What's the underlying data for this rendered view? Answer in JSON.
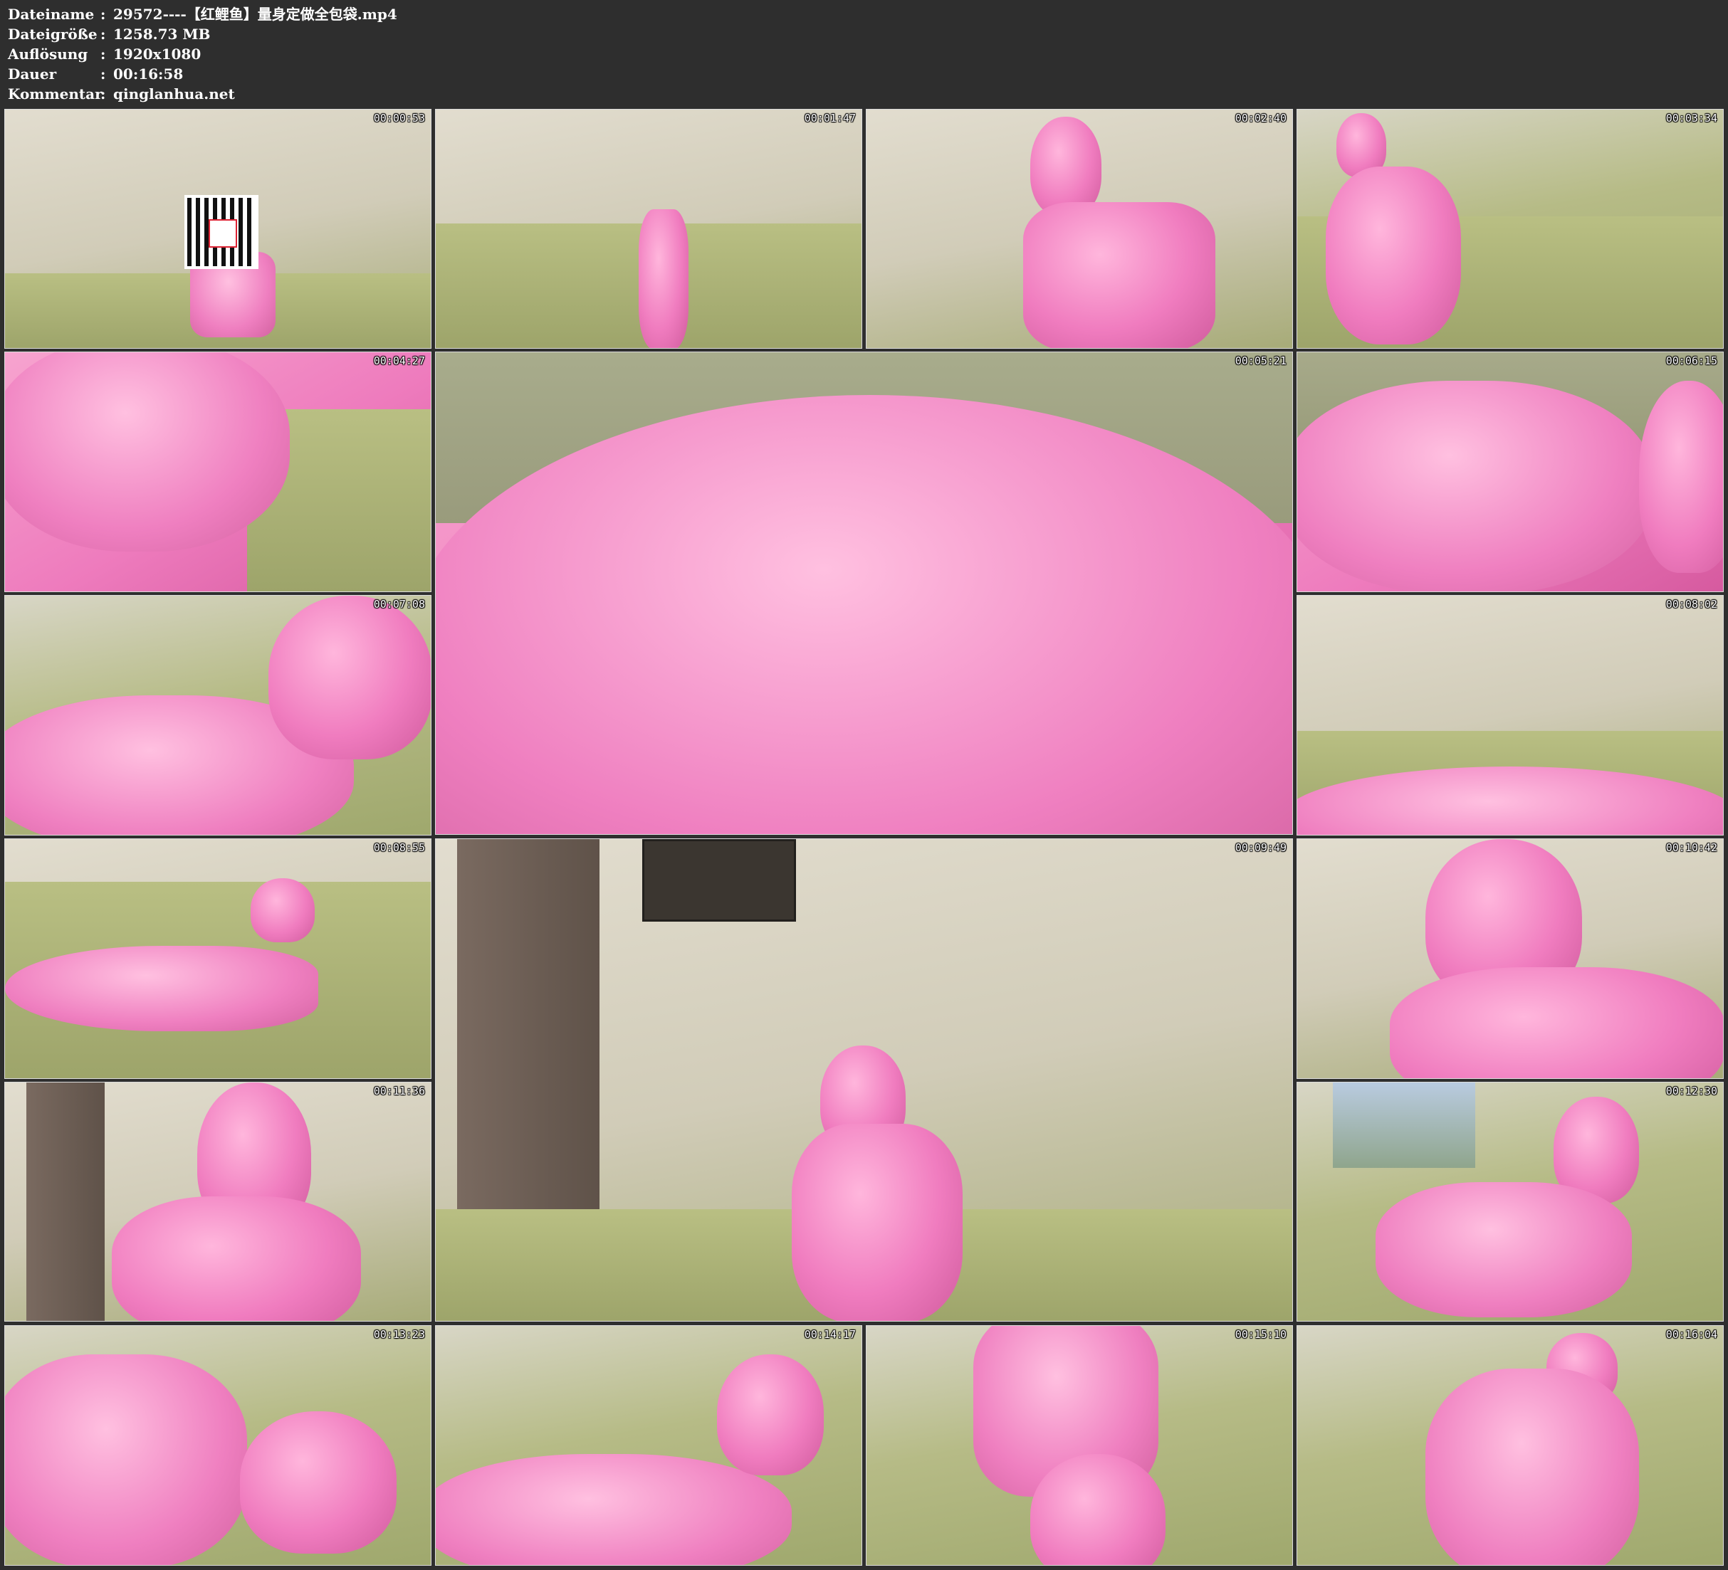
{
  "info": {
    "filename_label": "Dateiname",
    "filename_value": "29572----【红鲤鱼】量身定做全包袋.mp4",
    "filesize_label": "Dateigröße",
    "filesize_value": "1258.73 MB",
    "resolution_label": "Auflösung",
    "resolution_value": "1920x1080",
    "duration_label": "Dauer",
    "duration_value": "00:16:58",
    "comment_label": "Kommentar",
    "comment_value": "qinglanhua.net",
    "separator": ":"
  },
  "thumbnails": [
    {
      "time": "00:00:53"
    },
    {
      "time": "00:01:47"
    },
    {
      "time": "00:02:40"
    },
    {
      "time": "00:03:34"
    },
    {
      "time": "00:04:27"
    },
    {
      "time": "00:05:21"
    },
    {
      "time": "00:06:15"
    },
    {
      "time": "00:07:08"
    },
    {
      "time": "00:08:02"
    },
    {
      "time": "00:08:55"
    },
    {
      "time": "00:09:49"
    },
    {
      "time": "00:10:42"
    },
    {
      "time": "00:11:36"
    },
    {
      "time": "00:12:30"
    },
    {
      "time": "00:13:23"
    },
    {
      "time": "00:14:17"
    },
    {
      "time": "00:15:10"
    },
    {
      "time": "00:16:04"
    }
  ]
}
